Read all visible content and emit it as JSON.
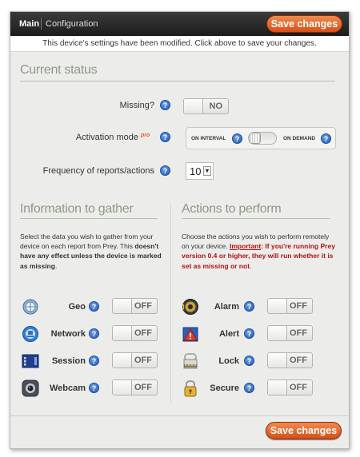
{
  "tabs": [
    {
      "label": "Main"
    },
    {
      "label": "Configuration"
    }
  ],
  "header": {
    "save_label": "Save changes"
  },
  "notice": "This device's settings have been modified. Click above to save your changes.",
  "current_status": {
    "title": "Current status",
    "missing": {
      "label": "Missing?",
      "value": "NO"
    },
    "activation": {
      "label": "Activation mode",
      "badge": "pro",
      "on_interval": "ON INTERVAL",
      "on_demand": "ON DEMAND"
    },
    "frequency": {
      "label": "Frequency of reports/actions",
      "value": "10"
    }
  },
  "gather": {
    "title": "Information to gather",
    "desc_plain": "Select the data you wish to gather from your device on each report from Prey. This ",
    "desc_bold": "doesn't have any effect unless the device is marked as missing",
    "desc_end": ".",
    "items": [
      {
        "label": "Geo",
        "value": "OFF",
        "icon": "globe-icon"
      },
      {
        "label": "Network",
        "value": "OFF",
        "icon": "network-icon"
      },
      {
        "label": "Session",
        "value": "OFF",
        "icon": "session-icon"
      },
      {
        "label": "Webcam",
        "value": "OFF",
        "icon": "webcam-icon"
      }
    ]
  },
  "actions": {
    "title": "Actions to perform",
    "desc_plain": "Choose the actions you wish to perform remotely on your device. ",
    "desc_important": "Important",
    "desc_red": ": If you're running Prey version 0.4 or higher, they will run whether it is set as missing or not",
    "desc_end": ".",
    "items": [
      {
        "label": "Alarm",
        "value": "OFF",
        "icon": "speaker-icon"
      },
      {
        "label": "Alert",
        "value": "OFF",
        "icon": "warning-icon"
      },
      {
        "label": "Lock",
        "value": "OFF",
        "icon": "lock-icon"
      },
      {
        "label": "Secure",
        "value": "OFF",
        "icon": "padlock-icon"
      }
    ]
  },
  "footer": {
    "save_label": "Save changes"
  },
  "help_glyph": "?",
  "colors": {
    "accent": "#e0621f",
    "topbar": "#262626",
    "section_title": "#8f9a86",
    "warning_text": "#b01212"
  }
}
